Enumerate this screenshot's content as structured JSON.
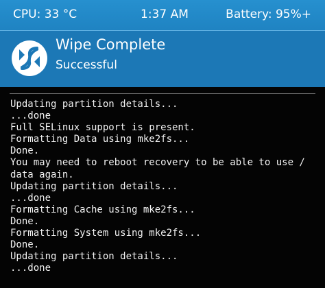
{
  "status_bar": {
    "cpu": "CPU: 33 °C",
    "time": "1:37 AM",
    "battery": "Battery: 95%+"
  },
  "header": {
    "icon": "twrp-logo-icon",
    "title": "Wipe Complete",
    "subtitle": "Successful"
  },
  "console": {
    "lines": [
      "Updating partition details...",
      "...done",
      "Full SELinux support is present.",
      "Formatting Data using mke2fs...",
      "Done.",
      "You may need to reboot recovery to be able to use /",
      "data again.",
      "Updating partition details...",
      "...done",
      "Formatting Cache using mke2fs...",
      "Done.",
      "Formatting System using mke2fs...",
      "Done.",
      "Updating partition details...",
      "...done"
    ]
  },
  "colors": {
    "status_bar": "#2690cf",
    "header": "#1c78b6",
    "background": "#040404",
    "text": "#f2f2f2"
  }
}
